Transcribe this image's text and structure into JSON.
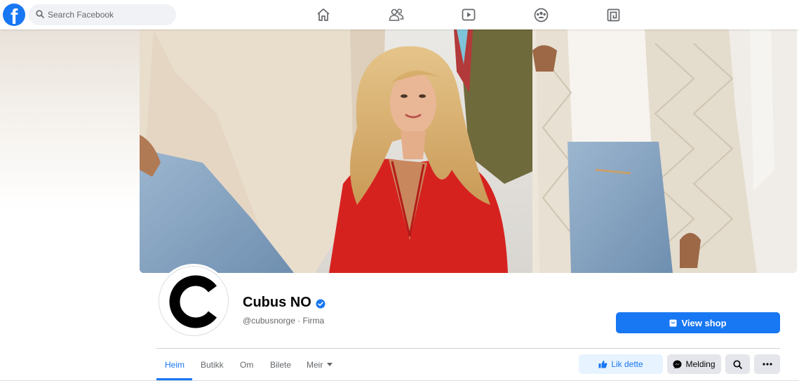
{
  "brand": {
    "logo_letter": "f",
    "accent": "#1877f2"
  },
  "search": {
    "placeholder": "Search Facebook"
  },
  "nav": {
    "icons": [
      "home-icon",
      "friends-icon",
      "watch-icon",
      "groups-icon",
      "gaming-icon"
    ]
  },
  "page": {
    "name": "Cubus NO",
    "handle": "@cubusnorge · Firma",
    "avatar_letter": "C",
    "verified": true
  },
  "actions": {
    "view_shop": "View shop",
    "like": "Lik dette",
    "message": "Melding"
  },
  "tabs": [
    {
      "label": "Heim",
      "active": true
    },
    {
      "label": "Butikk",
      "active": false
    },
    {
      "label": "Om",
      "active": false
    },
    {
      "label": "Bilete",
      "active": false
    },
    {
      "label": "Meir",
      "active": false
    }
  ],
  "colors": {
    "primary": "#1877f2",
    "like_bg": "#e7f3ff",
    "secondary_btn_bg": "#e4e6eb",
    "muted_text": "#65676b",
    "sweater_red": "#d6221f"
  }
}
